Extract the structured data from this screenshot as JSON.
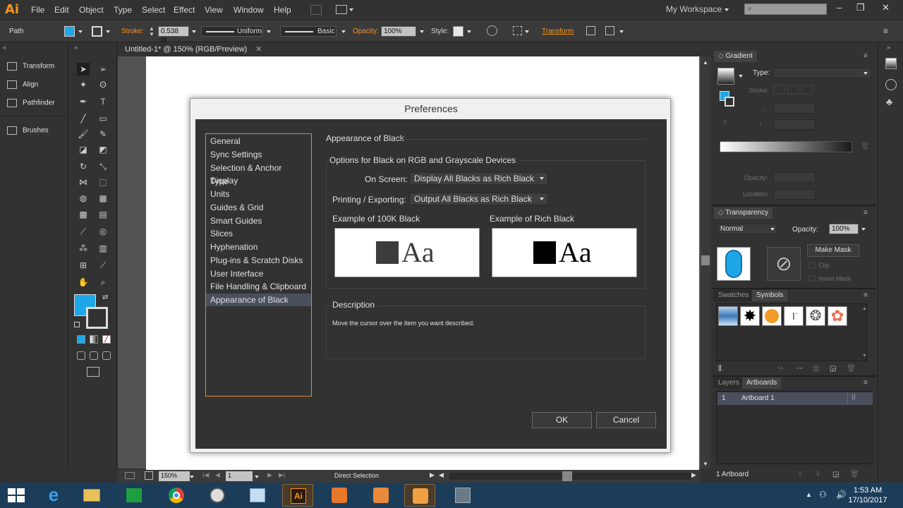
{
  "menubar": {
    "logo": "Ai",
    "items": [
      "File",
      "Edit",
      "Object",
      "Type",
      "Select",
      "Effect",
      "View",
      "Window",
      "Help"
    ],
    "workspace": "My Workspace"
  },
  "control": {
    "selection": "Path",
    "stroke_label": "Stroke:",
    "stroke_value": "0.538 pt",
    "stroke_profile": "Uniform",
    "brush": "Basic",
    "opacity_label": "Opacity:",
    "opacity_value": "100%",
    "style_label": "Style:",
    "transform_label": "Transform"
  },
  "left_panel": {
    "items": [
      "Transform",
      "Align",
      "Pathfinder",
      "Brushes"
    ]
  },
  "document": {
    "tab_title": "Untitled-1* @ 150% (RGB/Preview)"
  },
  "status": {
    "zoom": "150%",
    "page": "1",
    "tool": "Direct Selection"
  },
  "dialog": {
    "title": "Preferences",
    "categories": [
      "General",
      "Sync Settings",
      "Selection & Anchor Display",
      "Type",
      "Units",
      "Guides & Grid",
      "Smart Guides",
      "Slices",
      "Hyphenation",
      "Plug-ins & Scratch Disks",
      "User Interface",
      "File Handling & Clipboard",
      "Appearance of Black"
    ],
    "selected_category": "Appearance of Black",
    "section_title": "Appearance of Black",
    "group_title": "Options for Black on RGB and Grayscale Devices",
    "on_screen_label": "On Screen:",
    "on_screen_value": "Display All Blacks as Rich Black",
    "printing_label": "Printing / Exporting:",
    "printing_value": "Output All Blacks as Rich Black",
    "example_100k_label": "Example of 100K Black",
    "example_rich_label": "Example of Rich Black",
    "example_text": "Aa",
    "description_title": "Description",
    "description_text": "Move the cursor over the item you want described.",
    "ok_label": "OK",
    "cancel_label": "Cancel",
    "colors": {
      "black_100k": "#3c3c3c",
      "rich_black": "#000000"
    }
  },
  "right_panel": {
    "gradient": {
      "tab": "Gradient",
      "type_label": "Type:",
      "stroke_label": "Stroke:",
      "opacity_label": "Opacity:",
      "location_label": "Location:"
    },
    "transparency": {
      "tab": "Transparency",
      "blend_mode": "Normal",
      "opacity_label": "Opacity:",
      "opacity_value": "100%",
      "make_mask": "Make Mask",
      "clip": "Clip",
      "invert_mask": "Invert Mask"
    },
    "swatches_tab": "Swatches",
    "symbols_tab": "Symbols",
    "layers_tab": "Layers",
    "artboards_tab": "Artboards",
    "artboard_row": {
      "index": "1",
      "name": "Artboard 1"
    },
    "artboard_count": "1 Artboard"
  },
  "taskbar": {
    "time": "1:53 AM",
    "date": "17/10/2017"
  }
}
